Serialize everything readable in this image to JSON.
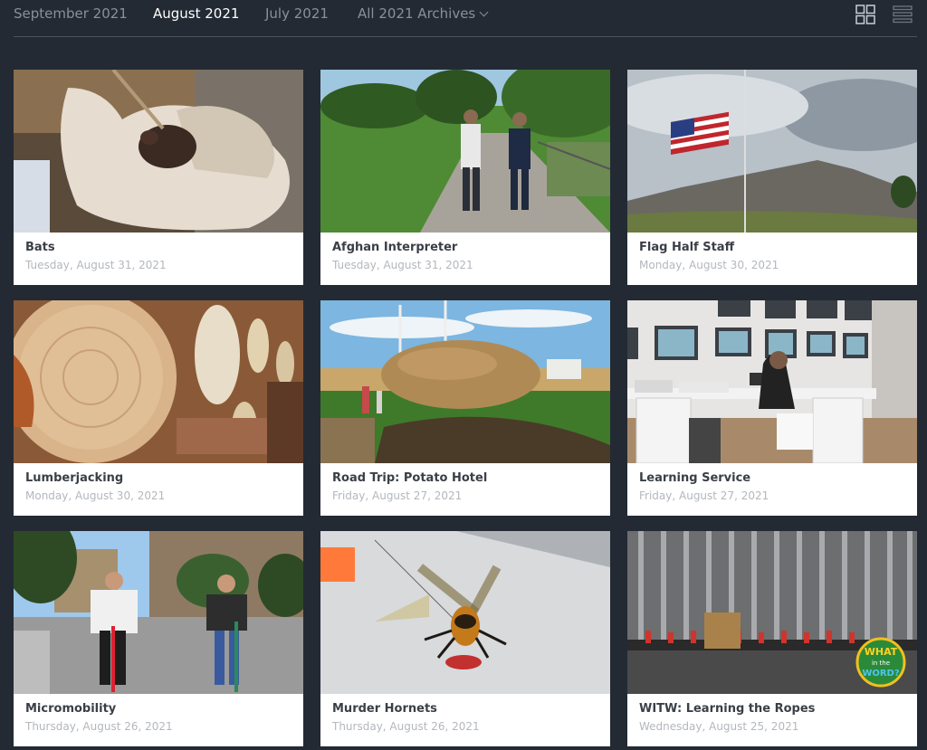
{
  "archive_nav": {
    "tabs": [
      {
        "label": "September 2021",
        "active": false
      },
      {
        "label": "August 2021",
        "active": true
      },
      {
        "label": "July 2021",
        "active": false
      },
      {
        "label": "All 2021 Archives",
        "active": false
      }
    ],
    "view_modes": [
      "grid-view-icon",
      "list-view-icon"
    ]
  },
  "posts": [
    {
      "title": "Bats",
      "date": "Tuesday, August 31, 2021"
    },
    {
      "title": "Afghan Interpreter",
      "date": "Tuesday, August 31, 2021"
    },
    {
      "title": "Flag Half Staff",
      "date": "Monday, August 30, 2021"
    },
    {
      "title": "Lumberjacking",
      "date": "Monday, August 30, 2021"
    },
    {
      "title": "Road Trip: Potato Hotel",
      "date": "Friday, August 27, 2021"
    },
    {
      "title": "Learning Service",
      "date": "Friday, August 27, 2021"
    },
    {
      "title": "Micromobility",
      "date": "Thursday, August 26, 2021"
    },
    {
      "title": "Murder Hornets",
      "date": "Thursday, August 26, 2021"
    },
    {
      "title": "WITW: Learning the Ropes",
      "date": "Wednesday, August 25, 2021",
      "logo_text": "WHAT in the WORD?"
    }
  ],
  "colors": {
    "background": "#232a34",
    "active_tab": "#ffffff",
    "inactive_tab": "#8a9099",
    "card_title": "#3a3f47",
    "card_date": "#b3b7bd"
  }
}
